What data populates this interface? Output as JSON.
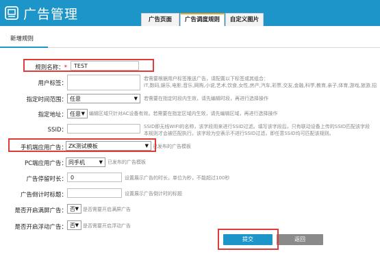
{
  "header": {
    "app_title": "广告管理",
    "tabs": [
      {
        "label": "广告页面",
        "active": false
      },
      {
        "label": "广告调度规则",
        "active": true
      },
      {
        "label": "自定义图片",
        "active": false
      }
    ]
  },
  "subnav": {
    "label": "新增规则"
  },
  "form": {
    "rule_name": {
      "label": "规则名称：",
      "required_mark": "*",
      "value": "TEST"
    },
    "user_tags": {
      "label": "用户标签：",
      "hint_line1": "若需要根据用户标签推送广告，请配置以下标签或其组合：",
      "hint_line2": "IT,数码,娱乐,电影,音乐,网购,小说,艺术,饮食,女性,房产,汽车,彩票,交友,金融,科学,教育,亲子,体育,游戏,旅游,招"
    },
    "time_range": {
      "label": "指定时间范围：",
      "value": "任意",
      "hint": "若需要在指定时段内生效，请先编辑时段，再进行选择操作"
    },
    "address": {
      "label": "指定地址：",
      "value": "任意",
      "hint": "编辑区域只针对AC设备有效。若需要在指定区域内生效，请先编辑区域，再进行选择操作"
    },
    "ssid": {
      "label": "SSID：",
      "hint_line1": "SSID即无线WIFI的名称，该字段用来进行SSID过滤。填写该字段后，只有联动设备上传的SSID匹配该字段",
      "hint_line2": "本规则才会被匹配执行。该字段为空表示不进行SSID过滤，即任意SSID均可匹配该规则。"
    },
    "mobile_page": {
      "label": "手机端应用广告：",
      "value": "ZK测试模板",
      "hint": "已发布的广告模板"
    },
    "pc_page": {
      "label": "PC端应用广告：",
      "value": "同手机",
      "hint": "已发布的广告模板"
    },
    "stay_time": {
      "label": "广告停留时长：",
      "value": "0",
      "hint": "设置展示广告的时长，单位为秒，不能超过100秒"
    },
    "countdown_title": {
      "label": "广告倒计时标题：",
      "hint": "设置展示广告倒计时的标题"
    },
    "fullscreen": {
      "label": "是否开启满屏广告：",
      "value": "否",
      "hint": "是否需要开启满屏广告"
    },
    "floating": {
      "label": "是否开启浮动广告：",
      "value": "否",
      "hint": "是否需要开启浮动广告"
    }
  },
  "buttons": {
    "submit": "提交",
    "back": "返回"
  },
  "colors": {
    "brand": "#1e95c8",
    "highlight": "#e03a3a",
    "tab_accent": "#e8a32c"
  }
}
